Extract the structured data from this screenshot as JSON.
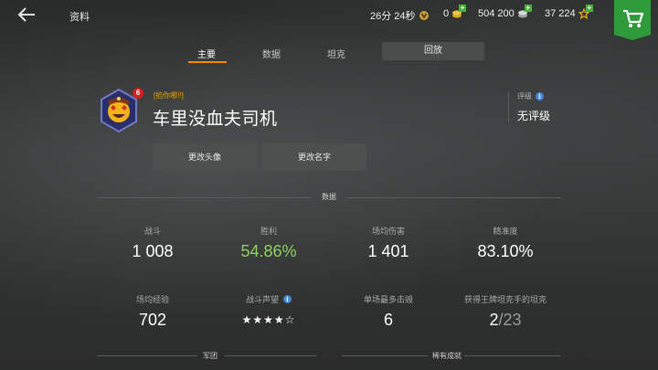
{
  "header": {
    "title": "资料",
    "timer": "26分 24秒",
    "gold": "0",
    "credits": "504 200",
    "free_xp": "37 224"
  },
  "tabs": [
    "主要",
    "数据",
    "坦克"
  ],
  "replay_label": "回放",
  "profile": {
    "clan_tag": "[掐你哪!!]",
    "name": "车里没血夫司机",
    "level_badge": "6",
    "rating_label": "评级",
    "rating_value": "无评级",
    "change_avatar": "更改头像",
    "change_name": "更改名字"
  },
  "stats_section_title": "数据",
  "stats": [
    {
      "label": "战斗",
      "value": "1 008"
    },
    {
      "label": "胜利",
      "value": "54.86%"
    },
    {
      "label": "场均伤害",
      "value": "1 401"
    },
    {
      "label": "精准度",
      "value": "83.10%"
    },
    {
      "label": "场均经验",
      "value": "702"
    },
    {
      "label": "战斗声望",
      "value": "★★★★☆"
    },
    {
      "label": "单场最多击毁",
      "value": "6"
    },
    {
      "label": "获得王牌坦克手的坦克",
      "value": "2",
      "value_total": "/23"
    }
  ],
  "stars_rating": 4,
  "sections_bottom": [
    "军团",
    "稀有成就"
  ],
  "colors": {
    "accent": "#f08a00",
    "win": "#8fd35f",
    "shop": "#2e9a3a",
    "clan": "#e8a200"
  }
}
